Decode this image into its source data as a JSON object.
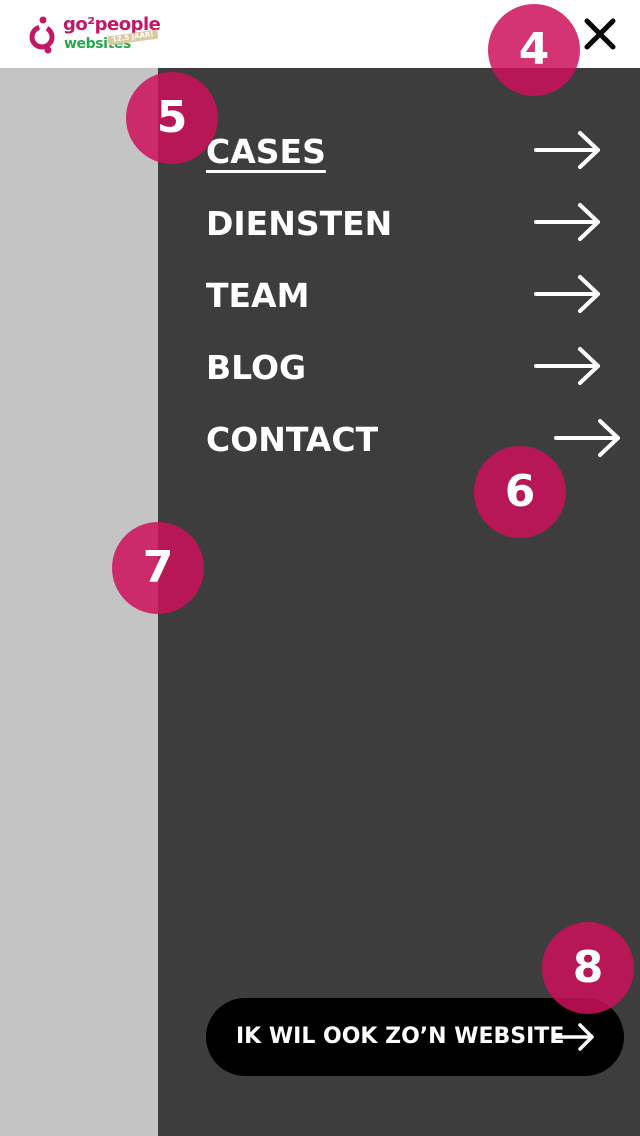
{
  "header": {
    "logo": {
      "top_text": "go²people",
      "bottom_text": "websites",
      "badge_text": "12.5 JAAR!",
      "brand_color": "#c21765",
      "secondary_color": "#27a84a"
    },
    "close_icon": "close-icon"
  },
  "menu": {
    "background": "#3d3d3d",
    "items": [
      {
        "label": "CASES",
        "active": true,
        "icon": "arrow-right-icon"
      },
      {
        "label": "DIENSTEN",
        "active": false,
        "icon": "arrow-right-icon"
      },
      {
        "label": "TEAM",
        "active": false,
        "icon": "arrow-right-icon"
      },
      {
        "label": "BLOG",
        "active": false,
        "icon": "arrow-right-icon"
      },
      {
        "label": "CONTACT",
        "active": false,
        "icon": "arrow-right-icon"
      }
    ]
  },
  "cta": {
    "label": "IK WIL OOK ZO’N WEBSITE",
    "icon": "arrow-right-icon"
  },
  "markers": [
    "4",
    "5",
    "6",
    "7",
    "8"
  ],
  "colors": {
    "marker": "#cc0f5c",
    "overlay": "#c4c4c4"
  }
}
